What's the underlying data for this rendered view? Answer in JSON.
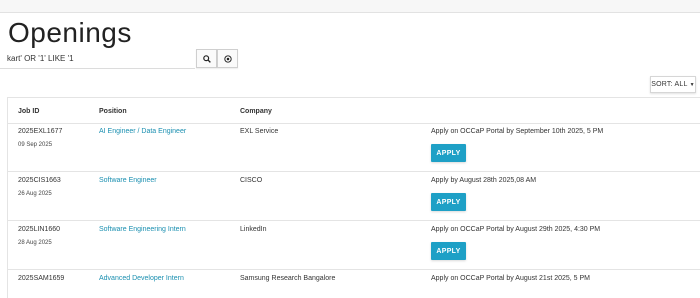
{
  "page": {
    "title": "Openings"
  },
  "search": {
    "value": "kart' OR '1' LIKE '1",
    "search_icon": "search-icon",
    "reset_icon": "target-icon"
  },
  "sort": {
    "label": "SORT: ALL"
  },
  "table": {
    "headers": {
      "job_id": "Job ID",
      "position": "Position",
      "company": "Company"
    },
    "rows": [
      {
        "job_id": "2025EXL1677",
        "date": "09 Sep 2025",
        "position": "AI Engineer / Data Engineer",
        "company": "EXL Service",
        "apply_text": "Apply on OCCaP Portal by September 10th 2025, 5 PM",
        "apply_label": "APPLY"
      },
      {
        "job_id": "2025CIS1663",
        "date": "26 Aug 2025",
        "position": "Software Engineer",
        "company": "CISCO",
        "apply_text": "Apply by August 28th 2025,08 AM",
        "apply_label": "APPLY"
      },
      {
        "job_id": "2025LIN1660",
        "date": "28 Aug 2025",
        "position": "Software Engineering Intern",
        "company": "LinkedIn",
        "apply_text": "Apply on OCCaP Portal by August 29th 2025, 4:30 PM",
        "apply_label": "APPLY"
      },
      {
        "job_id": "2025SAM1659",
        "date": "",
        "position": "Advanced Developer Intern",
        "company": "Samsung Research Bangalore",
        "apply_text": "Apply on OCCaP Portal by August 21st 2025, 5 PM",
        "apply_label": ""
      }
    ]
  },
  "colors": {
    "link": "#1a8fb0",
    "apply_button": "#1ea0c6"
  }
}
